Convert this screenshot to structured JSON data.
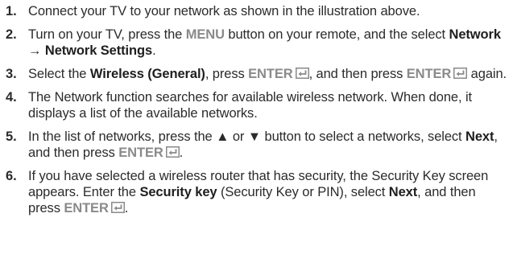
{
  "steps": [
    {
      "number": "1.",
      "parts": [
        "Connect your TV to your network as shown in the illustration above."
      ]
    },
    {
      "number": "2.",
      "parts": [
        "Turn on your TV, press the ",
        "MENU",
        " button on your remote, and the select ",
        "Network",
        " → ",
        "Network Settings",
        "."
      ]
    },
    {
      "number": "3.",
      "parts": [
        "Select the ",
        "Wireless (General)",
        ", press ",
        "ENTER",
        ", and then press ",
        "ENTER",
        " again."
      ]
    },
    {
      "number": "4.",
      "parts": [
        "The Network function searches for available wireless network. When done, it displays a list of the available networks."
      ]
    },
    {
      "number": "5.",
      "parts": [
        "In the list of networks, press the ▲ or ▼ button to select a networks, select ",
        "Next",
        ", and then press ",
        "ENTER",
        "."
      ]
    },
    {
      "number": "6.",
      "parts": [
        "If you have selected a wireless router that has security, the Security Key screen appears. Enter the ",
        "Security key",
        " (Security Key or PIN), select ",
        "Next",
        ", and then press ",
        "ENTER",
        "."
      ]
    }
  ],
  "icons": {
    "enter": "enter-key-icon"
  },
  "colors": {
    "text": "#2b2b2b",
    "key_label": "#8a8a8a"
  }
}
